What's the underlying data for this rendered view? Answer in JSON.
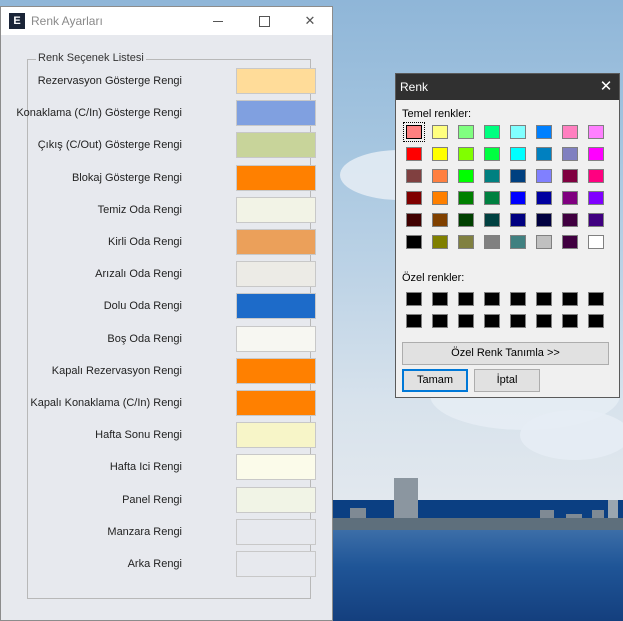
{
  "main_window": {
    "title": "Renk Ayarları",
    "app_icon_letter": "E",
    "group_title": "Renk Seçenek Listesi",
    "rows": [
      {
        "label": "Rezervasyon Gösterge Rengi",
        "color": "#ffdc99"
      },
      {
        "label": "Konaklama (C/In) Gösterge Rengi",
        "color": "#80a0e0"
      },
      {
        "label": "Çıkış (C/Out) Gösterge Rengi",
        "color": "#c8d49a"
      },
      {
        "label": "Blokaj Gösterge Rengi",
        "color": "#ff8000"
      },
      {
        "label": "Temiz Oda Rengi",
        "color": "#f2f3e6"
      },
      {
        "label": "Kirli Oda Rengi",
        "color": "#eba05a"
      },
      {
        "label": "Arızalı Oda Rengi",
        "color": "#ecebe6"
      },
      {
        "label": "Dolu Oda Rengi",
        "color": "#1d6bc9"
      },
      {
        "label": "Boş Oda Rengi",
        "color": "#f7f7f2"
      },
      {
        "label": "Kapalı Rezervasyon Rengi",
        "color": "#ff8000"
      },
      {
        "label": "Kapalı Konaklama (C/In) Rengi",
        "color": "#ff8000"
      },
      {
        "label": "Hafta Sonu Rengi",
        "color": "#f7f5c8"
      },
      {
        "label": "Hafta Ici Rengi",
        "color": "#fbfbea"
      },
      {
        "label": "Panel Rengi",
        "color": "#f1f4e6"
      },
      {
        "label": "Manzara Rengi",
        "color": "#e7e9ee"
      },
      {
        "label": "Arka Rengi",
        "color": "#e7e9ee"
      }
    ]
  },
  "color_dialog": {
    "title": "Renk",
    "basic_label": "Temel renkler:",
    "custom_label": "Özel renkler:",
    "define_custom_button": "Özel Renk Tanımla >>",
    "ok_button": "Tamam",
    "cancel_button": "İptal",
    "selected_basic_index": 0,
    "basic_colors": [
      "#ff8080",
      "#ffff80",
      "#80ff80",
      "#00ff80",
      "#80ffff",
      "#0080ff",
      "#ff80c0",
      "#ff80ff",
      "#ff0000",
      "#ffff00",
      "#80ff00",
      "#00ff40",
      "#00ffff",
      "#0080c0",
      "#8080c0",
      "#ff00ff",
      "#804040",
      "#ff8040",
      "#00ff00",
      "#008080",
      "#004080",
      "#8080ff",
      "#800040",
      "#ff0080",
      "#800000",
      "#ff8000",
      "#008000",
      "#008040",
      "#0000ff",
      "#0000a0",
      "#800080",
      "#8000ff",
      "#400000",
      "#804000",
      "#004000",
      "#004040",
      "#000080",
      "#000040",
      "#400040",
      "#400080",
      "#000000",
      "#808000",
      "#808040",
      "#808080",
      "#408080",
      "#c0c0c0",
      "#400040",
      "#ffffff"
    ],
    "custom_colors": [
      "#000000",
      "#000000",
      "#000000",
      "#000000",
      "#000000",
      "#000000",
      "#000000",
      "#000000",
      "#000000",
      "#000000",
      "#000000",
      "#000000",
      "#000000",
      "#000000",
      "#000000",
      "#000000"
    ]
  }
}
